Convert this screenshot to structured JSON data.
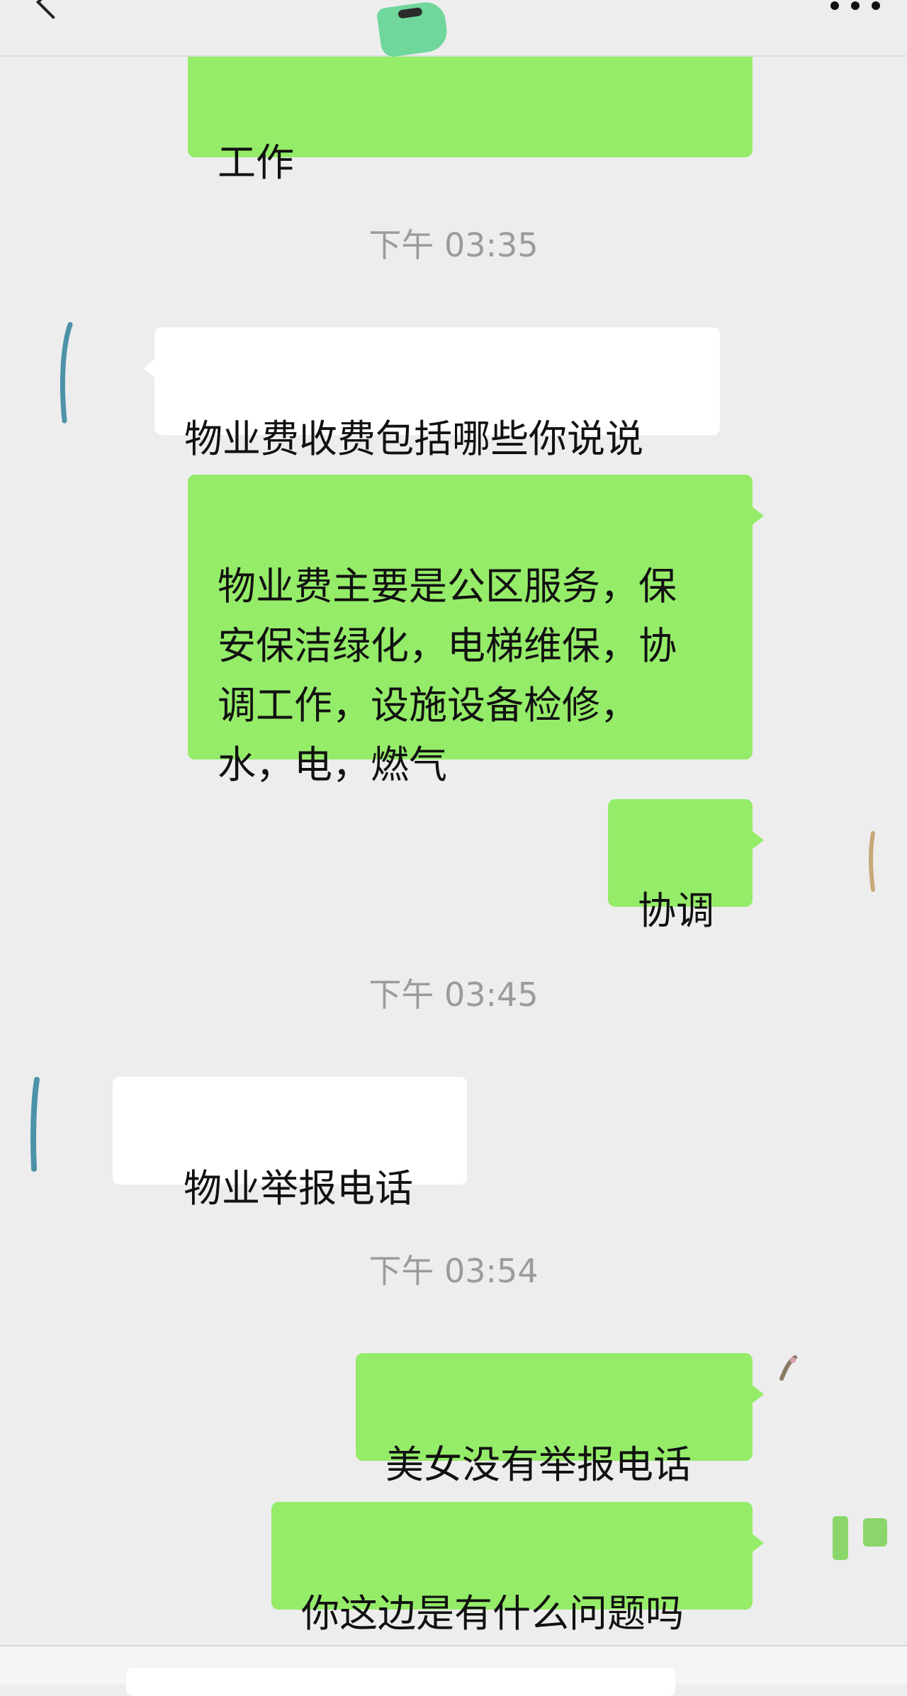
{
  "header": {
    "back_icon": "chevron-left-icon",
    "more_icon": "more-horizontal-icon"
  },
  "messages": [
    {
      "type": "sent",
      "text": "工作"
    },
    {
      "type": "timestamp",
      "text": "下午 03:35"
    },
    {
      "type": "received",
      "text": "物业费收费包括哪些你说说"
    },
    {
      "type": "sent",
      "text": "物业费主要是公区服务，保\n安保洁绿化，电梯维保，协\n调工作，设施设备检修，\n水，电，燃气"
    },
    {
      "type": "sent",
      "text": "协调"
    },
    {
      "type": "timestamp",
      "text": "下午 03:45"
    },
    {
      "type": "received",
      "text": "物业举报电话"
    },
    {
      "type": "timestamp",
      "text": "下午 03:54"
    },
    {
      "type": "sent",
      "text": "美女没有举报电话"
    },
    {
      "type": "sent",
      "text": "你这边是有什么问题吗"
    }
  ],
  "colors": {
    "background": "#ededed",
    "sent_bubble": "#95ec69",
    "received_bubble": "#ffffff",
    "timestamp_text": "#9b9b9b"
  }
}
